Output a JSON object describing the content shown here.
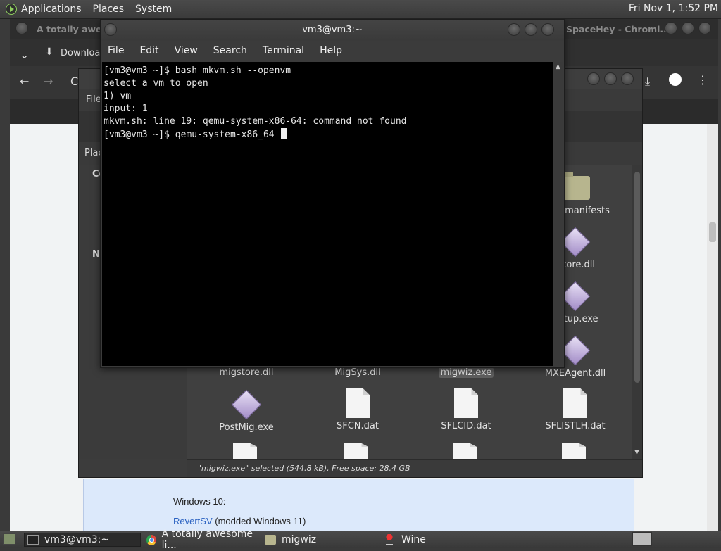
{
  "top_panel": {
    "menus": [
      "Applications",
      "Places",
      "System"
    ],
    "clock": "Fri Nov 1, 1:52 PM"
  },
  "chromium": {
    "title_left": "A totally awesome",
    "title_right": "SpaceHey - Chromi...",
    "download_label": "Download",
    "page": {
      "heading": "Windows 10:",
      "link": "RevertSV",
      "link_suffix": "(modded Windows 11)"
    }
  },
  "file_manager": {
    "menu_partial": "File",
    "places_partial": "Plac",
    "side_labels": [
      "Co",
      "Ne"
    ],
    "files": [
      {
        "name": "mentmanifests",
        "icon": "folder-icon"
      },
      {
        "name": "gcore.dll",
        "icon": "exe-icon"
      },
      {
        "name": "Setup.exe",
        "icon": "exe-icon"
      },
      {
        "name": "migstore.dll",
        "icon": "none"
      },
      {
        "name": "MigSys.dll",
        "icon": "none"
      },
      {
        "name": "migwiz.exe",
        "icon": "none",
        "selected": true
      },
      {
        "name": "MXEAgent.dll",
        "icon": "exe-icon"
      },
      {
        "name": "PostMig.exe",
        "icon": "exe-icon"
      },
      {
        "name": "SFCN.dat",
        "icon": "doc-icon"
      },
      {
        "name": "SFLCID.dat",
        "icon": "doc-icon"
      },
      {
        "name": "SFLISTLH.dat",
        "icon": "doc-icon"
      }
    ],
    "status": "\"migwiz.exe\" selected (544.8 kB), Free space: 28.4 GB"
  },
  "terminal": {
    "title": "vm3@vm3:~",
    "menu": [
      "File",
      "Edit",
      "View",
      "Search",
      "Terminal",
      "Help"
    ],
    "lines": [
      "[vm3@vm3 ~]$ bash mkvm.sh --openvm",
      "select a vm to open",
      "1) vm",
      "input: 1",
      "mkvm.sh: line 19: qemu-system-x86-64: command not found"
    ],
    "prompt": "[vm3@vm3 ~]$ qemu-system-x86_64 "
  },
  "taskbar": {
    "items": [
      {
        "label": "vm3@vm3:~",
        "icon": "terminal-icon",
        "active": true
      },
      {
        "label": "A totally awesome li...",
        "icon": "chromium-icon",
        "active": false
      },
      {
        "label": "migwiz",
        "icon": "folder-icon",
        "active": false
      },
      {
        "label": "Wine",
        "icon": "wine-icon",
        "active": false
      }
    ]
  }
}
